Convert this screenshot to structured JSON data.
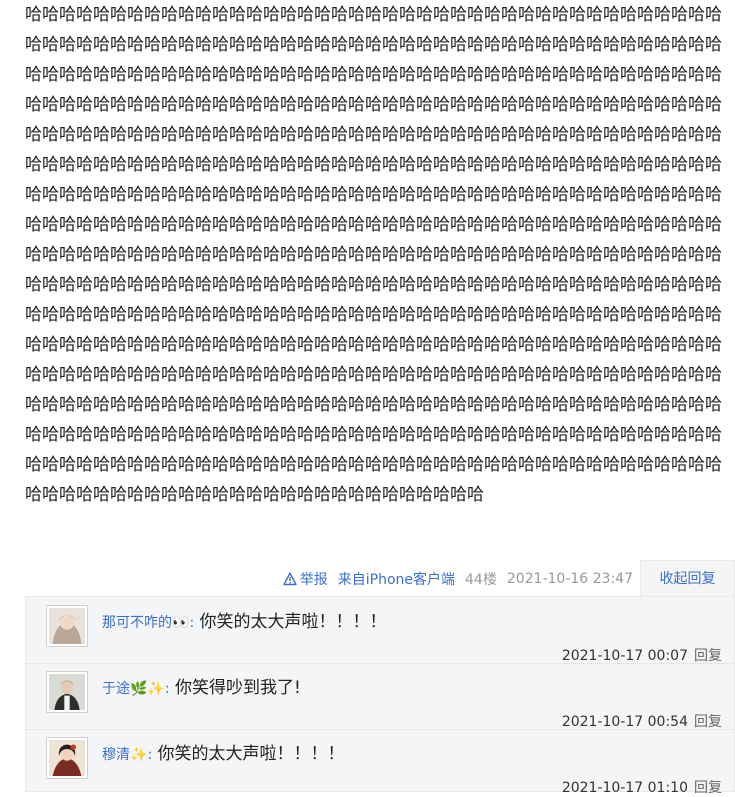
{
  "post": {
    "content": "哈哈哈哈哈哈哈哈哈哈哈哈哈哈哈哈哈哈哈哈哈哈哈哈哈哈哈哈哈哈哈哈哈哈哈哈哈哈哈哈哈哈哈哈哈哈哈哈哈哈哈哈哈哈哈哈哈哈哈哈哈哈哈哈哈哈哈哈哈哈哈哈哈哈哈哈哈哈哈哈哈哈哈哈哈哈哈哈哈哈哈哈哈哈哈哈哈哈哈哈哈哈哈哈哈哈哈哈哈哈哈哈哈哈哈哈哈哈哈哈哈哈哈哈哈哈哈哈哈哈哈哈哈哈哈哈哈哈哈哈哈哈哈哈哈哈哈哈哈哈哈哈哈哈哈哈哈哈哈哈哈哈哈哈哈哈哈哈哈哈哈哈哈哈哈哈哈哈哈哈哈哈哈哈哈哈哈哈哈哈哈哈哈哈哈哈哈哈哈哈哈哈哈哈哈哈哈哈哈哈哈哈哈哈哈哈哈哈哈哈哈哈哈哈哈哈哈哈哈哈哈哈哈哈哈哈哈哈哈哈哈哈哈哈哈哈哈哈哈哈哈哈哈哈哈哈哈哈哈哈哈哈哈哈哈哈哈哈哈哈哈哈哈哈哈哈哈哈哈哈哈哈哈哈哈哈哈哈哈哈哈哈哈哈哈哈哈哈哈哈哈哈哈哈哈哈哈哈哈哈哈哈哈哈哈哈哈哈哈哈哈哈哈哈哈哈哈哈哈哈哈哈哈哈哈哈哈哈哈哈哈哈哈哈哈哈哈哈哈哈哈哈哈哈哈哈哈哈哈哈哈哈哈哈哈哈哈哈哈哈哈哈哈哈哈哈哈哈哈哈哈哈哈哈哈哈哈哈哈哈哈哈哈哈哈哈哈哈哈哈哈哈哈哈哈哈哈哈哈哈哈哈哈哈哈哈哈哈哈哈哈哈哈哈哈哈哈哈哈哈哈哈哈哈哈哈哈哈哈哈哈哈哈哈哈哈哈哈哈哈哈哈哈哈哈哈哈哈哈哈哈哈哈哈哈哈哈哈哈哈哈哈哈哈哈哈哈哈哈哈哈哈哈哈哈哈哈哈哈哈哈哈哈哈哈哈哈哈哈哈哈哈哈哈哈哈哈哈哈哈哈哈哈哈哈哈哈哈哈哈哈哈哈哈哈哈哈哈哈哈哈哈哈哈哈哈哈哈哈哈哈哈哈哈哈哈哈哈哈哈哈哈哈哈哈哈哈哈哈哈哈哈哈哈哈哈哈哈哈哈哈哈哈哈哈哈哈哈哈哈哈哈哈哈哈哈哈哈哈哈哈哈哈哈哈哈哈哈哈哈哈哈哈哈哈哈哈哈哈哈哈哈哈哈哈哈哈哈哈哈哈哈哈哈哈哈哈哈哈哈哈哈哈哈哈哈哈哈哈哈哈哈哈哈哈哈哈哈哈哈哈哈哈哈哈哈哈哈哈哈哈哈哈哈哈哈哈哈哈哈哈哈哈哈哈哈哈哈哈哈哈哈哈"
  },
  "post_tail": {
    "report_label": "举报",
    "source": "来自iPhone客户端",
    "floor": "44楼",
    "datetime": "2021-10-16 23:47",
    "collapse_label": "收起回复"
  },
  "replies": [
    {
      "user": "那可不咋的👀",
      "colon": ":",
      "text": " 你笑的太大声啦！！！！",
      "time": "2021-10-17 00:07",
      "reply_label": "回复"
    },
    {
      "user": "于途🌿✨",
      "colon": ":",
      "text": " 你笑得吵到我了!",
      "time": "2021-10-17 00:54",
      "reply_label": "回复"
    },
    {
      "user": "穆清✨",
      "colon": ":",
      "text": " 你笑的太大声啦！！！！",
      "time": "2021-10-17 01:10",
      "reply_label": "回复"
    }
  ],
  "colors": {
    "link": "#3a6fcf",
    "reply_panel_bg": "#f4f5f7",
    "meta_gray": "#999999"
  }
}
